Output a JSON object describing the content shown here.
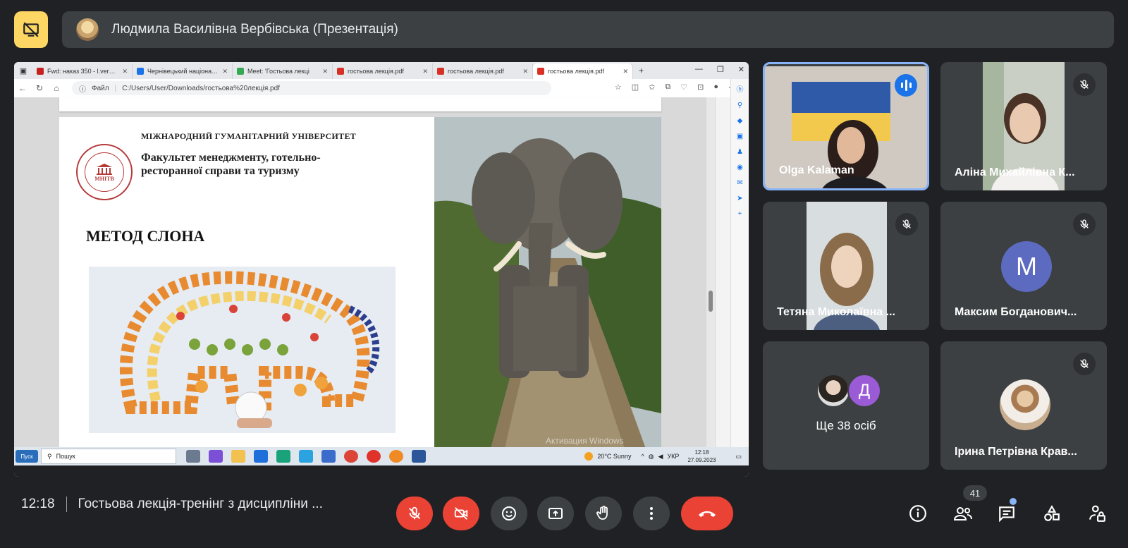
{
  "header": {
    "presenter_title": "Людмила Василівна Вербівська (Презентація)"
  },
  "shared_screen": {
    "tabs": [
      {
        "label": "Fwd: наказ 350 - l.verbivska",
        "color": "#c5221f"
      },
      {
        "label": "Чернівецький національн",
        "color": "#1a73e8"
      },
      {
        "label": "Meet: 'Гостьова лекці",
        "color": "#34a853"
      },
      {
        "label": "гостьова лекція.pdf",
        "color": "#d93025"
      },
      {
        "label": "гостьова лекція.pdf",
        "color": "#d93025"
      },
      {
        "label": "гостьова лекція.pdf",
        "color": "#d93025"
      }
    ],
    "url_prefix": "Файл",
    "url": "C:/Users/User/Downloads/гостьова%20лекція.pdf",
    "slide": {
      "university": "МІЖНАРОДНИЙ ГУМАНІТАРНИЙ УНІВЕРСИТЕТ",
      "seal_text": "МНІТВ",
      "faculty": "Факультет менеджменту, готельно-ресторанної справи та туризму",
      "method_title": "МЕТОД СЛОНА"
    },
    "watermark": "Активация Windows",
    "taskbar": {
      "start_label": "Пуск",
      "search_placeholder": "Пошук",
      "weather": "20°C  Sunny",
      "lang": "УКР",
      "clock_time": "12:18",
      "clock_date": "27.09.2023"
    }
  },
  "participants": [
    {
      "name": "Olga Kalaman",
      "speaking": true
    },
    {
      "name": "Аліна Михайлівна К...",
      "muted": true
    },
    {
      "name": "Тетяна Миколаївна ...",
      "muted": true
    },
    {
      "name": "Максим Богданович...",
      "muted": true,
      "initial": "M"
    },
    {
      "more_initial": "Д",
      "more_label": "Ще 38 осіб"
    },
    {
      "name": "Ірина Петрівна Крав...",
      "muted": true
    }
  ],
  "footer": {
    "time": "12:18",
    "meeting_title": "Гостьова лекція-тренінг з дисципліни ...",
    "participant_count": "41"
  },
  "colors": {
    "background": "#202124",
    "tile": "#3c4043",
    "danger": "#ea4335",
    "accent": "#8ab4f8",
    "present_button": "#fdd663"
  }
}
